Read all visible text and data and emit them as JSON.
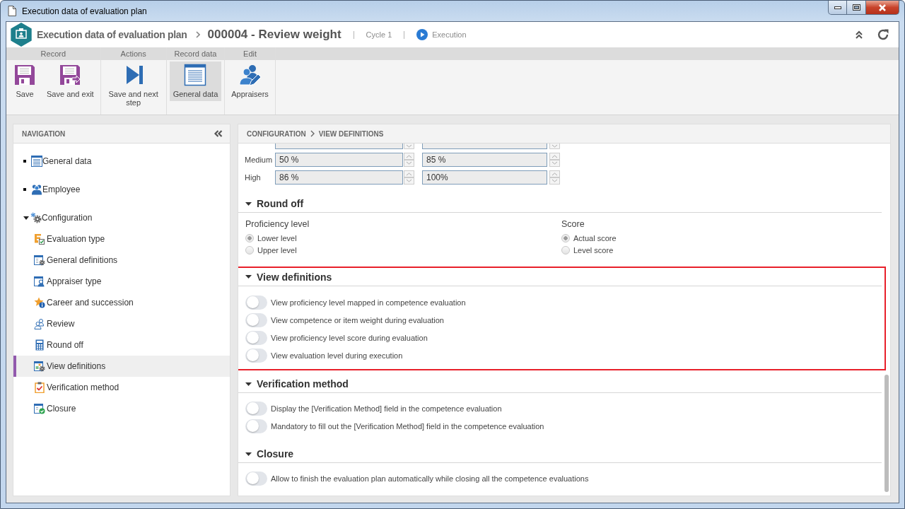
{
  "window": {
    "title": "Execution data of evaluation plan"
  },
  "header": {
    "module": "Execution data of evaluation plan",
    "record": "000004 - Review weight",
    "cycle": "Cycle 1",
    "status": "Execution"
  },
  "toolbar": [
    {
      "label": "Record",
      "buttons": [
        {
          "label": "Save",
          "selected": false
        },
        {
          "label": "Save and exit",
          "selected": false
        }
      ]
    },
    {
      "label": "Actions",
      "buttons": [
        {
          "label": "Save and next step",
          "selected": false
        }
      ]
    },
    {
      "label": "Record data",
      "buttons": [
        {
          "label": "General data",
          "selected": true
        }
      ]
    },
    {
      "label": "Edit",
      "buttons": [
        {
          "label": "Appraisers",
          "selected": false
        }
      ]
    }
  ],
  "navigation": {
    "title": "NAVIGATION",
    "items": [
      {
        "label": "General data",
        "selected": false
      },
      {
        "label": "Employee",
        "selected": false
      },
      {
        "label": "Configuration",
        "selected": false,
        "expanded": true,
        "children": [
          {
            "label": "Evaluation type",
            "selected": false
          },
          {
            "label": "General definitions",
            "selected": false
          },
          {
            "label": "Appraiser type",
            "selected": false
          },
          {
            "label": "Career and succession",
            "selected": false
          },
          {
            "label": "Review",
            "selected": false
          },
          {
            "label": "Round off",
            "selected": false
          },
          {
            "label": "View definitions",
            "selected": true
          },
          {
            "label": "Verification method",
            "selected": false
          },
          {
            "label": "Closure",
            "selected": false
          }
        ]
      }
    ]
  },
  "content": {
    "breadcrumb": [
      "CONFIGURATION",
      "VIEW DEFINITIONS"
    ],
    "ranges": [
      {
        "label": "Medium",
        "from": "50 %",
        "to": "85 %"
      },
      {
        "label": "High",
        "from": "86 %",
        "to": "100%"
      }
    ],
    "sections": [
      {
        "kind": "radios",
        "title": "Round off",
        "expanded": true,
        "highlighted": false,
        "groups": [
          {
            "label": "Proficiency level",
            "options": [
              {
                "label": "Lower level",
                "selected": true
              },
              {
                "label": "Upper level",
                "selected": false
              }
            ]
          },
          {
            "label": "Score",
            "options": [
              {
                "label": "Actual score",
                "selected": true
              },
              {
                "label": "Level score",
                "selected": false
              }
            ]
          }
        ]
      },
      {
        "kind": "toggles",
        "title": "View definitions",
        "expanded": true,
        "highlighted": true,
        "toggles": [
          {
            "label": "View proficiency level mapped in competence evaluation",
            "on": false
          },
          {
            "label": "View competence or item weight during evaluation",
            "on": false
          },
          {
            "label": "View proficiency level score during evaluation",
            "on": false
          },
          {
            "label": "View evaluation level during execution",
            "on": false
          }
        ]
      },
      {
        "kind": "toggles",
        "title": "Verification method",
        "expanded": true,
        "highlighted": false,
        "toggles": [
          {
            "label": "Display the [Verification Method] field in the competence evaluation",
            "on": false
          },
          {
            "label": "Mandatory to fill out the [Verification Method] field in the competence evaluation",
            "on": false
          }
        ]
      },
      {
        "kind": "toggles",
        "title": "Closure",
        "expanded": true,
        "highlighted": false,
        "toggles": [
          {
            "label": "Allow to finish the evaluation plan automatically while closing all the competence evaluations",
            "on": false
          }
        ]
      }
    ]
  }
}
